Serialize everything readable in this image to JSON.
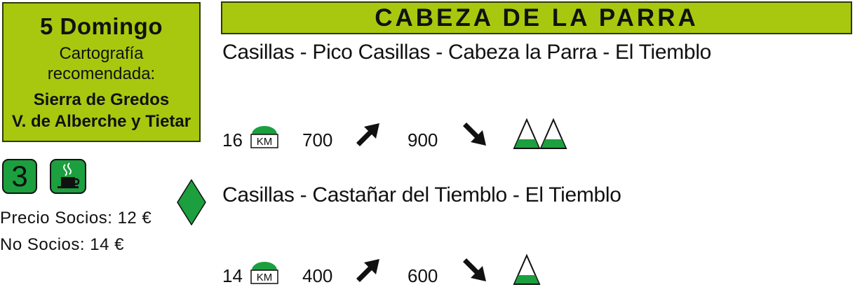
{
  "info": {
    "day": "5 Domingo",
    "carto_label": "Cartografía recomendada:",
    "maps": [
      "Sierra de Gredos",
      "V. de Alberche y Tietar"
    ]
  },
  "title": "CABEZA DE LA PARRA",
  "routes": [
    {
      "name": "Casillas - Pico Casillas - Cabeza la Parra - El Tiemblo",
      "distance": "16",
      "km_label": "KM",
      "ascent": "700",
      "descent": "900",
      "difficulty_peaks": 2
    },
    {
      "name": "Casillas - Castañar del Tiemblo - El Tiemblo",
      "distance": "14",
      "km_label": "KM",
      "ascent": "400",
      "descent": "600",
      "difficulty_peaks": 1
    }
  ],
  "badges": {
    "difficulty": "3",
    "food_icon": "coffee-cup-icon"
  },
  "prices": {
    "socios": "Precio Socios: 12 €",
    "no_socios": "No Socios: 14 €"
  },
  "colors": {
    "accent": "#a8c80f",
    "green": "#1c9f3e",
    "dark": "#111111"
  }
}
